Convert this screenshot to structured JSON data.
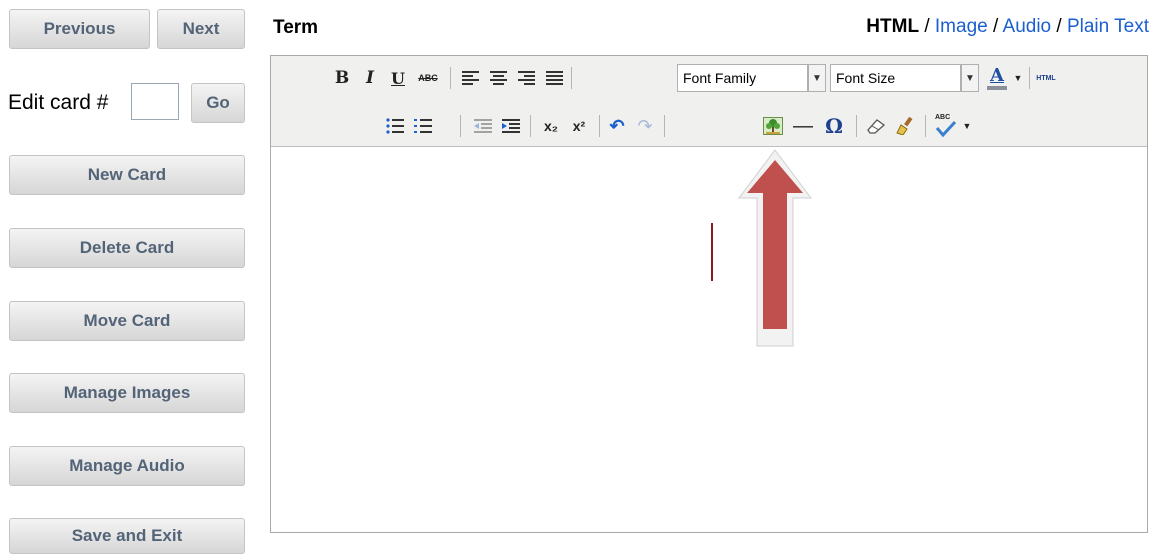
{
  "nav": {
    "previous": "Previous",
    "next": "Next"
  },
  "edit": {
    "label": "Edit card #",
    "value": "",
    "go": "Go"
  },
  "actions": [
    "New Card",
    "Delete Card",
    "Move Card",
    "Manage Images",
    "Manage Audio",
    "Save and Exit"
  ],
  "term": {
    "label": "Term"
  },
  "content_types": {
    "current": "HTML",
    "separator": " / ",
    "image": "Image",
    "audio": "Audio",
    "plain_text": "Plain Text"
  },
  "toolbar": {
    "bold": "B",
    "italic": "I",
    "underline": "U",
    "strike": "ABC",
    "font_family": "Font Family",
    "font_size": "Font Size",
    "font_color": "A",
    "html": "HTML",
    "subscript": "x₂",
    "superscript": "x²",
    "undo": "↶",
    "redo": "↷",
    "horizontal_rule": "—",
    "special_char": "Ω",
    "spellcheck": "ABC"
  },
  "colors": {
    "button_text": "#546478",
    "link": "#1b5fd0",
    "arrow_fill": "#c0504d",
    "arrow_outline": "#f2f2f2"
  },
  "icons": [
    "bold",
    "italic",
    "underline",
    "strikethrough",
    "align-left-icon",
    "align-center-icon",
    "align-right-icon",
    "align-justify-icon",
    "font-color-icon",
    "bullet-list-icon",
    "numbered-list-icon",
    "outdent-icon",
    "indent-icon",
    "undo-icon",
    "redo-icon",
    "insert-image-icon",
    "eraser-icon",
    "paintbrush-icon",
    "spellcheck-icon",
    "up-arrow-annotation"
  ]
}
